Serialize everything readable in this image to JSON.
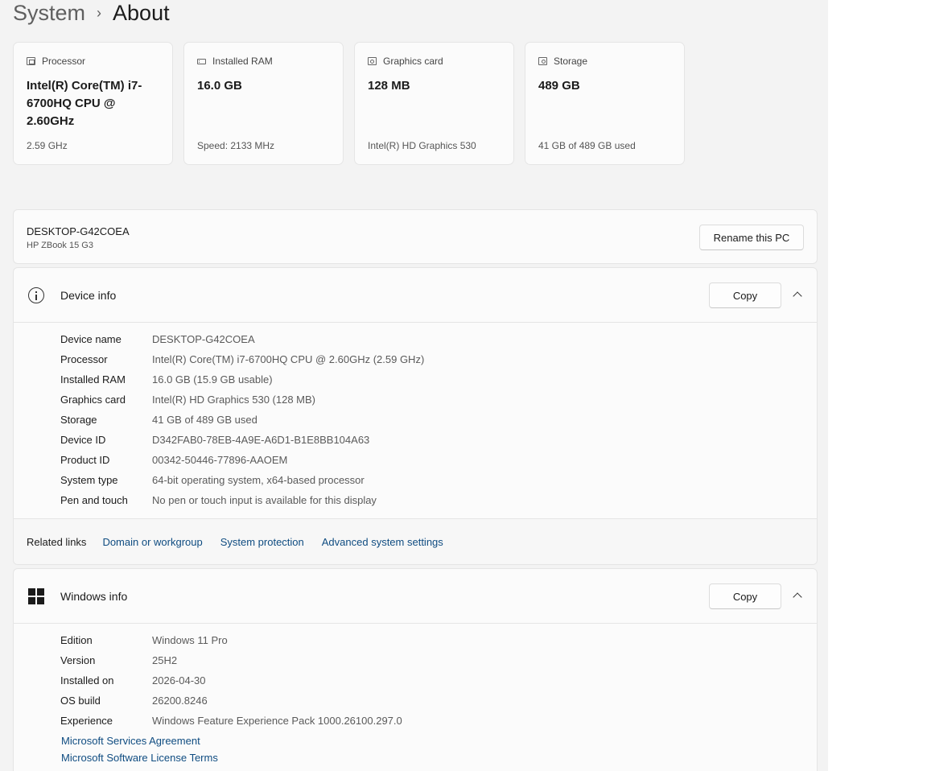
{
  "breadcrumb": {
    "parent": "System",
    "separator": "›",
    "current": "About"
  },
  "spec_cards": [
    {
      "icon": "processor-icon",
      "label": "Processor",
      "value": "Intel(R) Core(TM) i7-6700HQ CPU @ 2.60GHz",
      "sub": "2.59 GHz"
    },
    {
      "icon": "ram-icon",
      "label": "Installed RAM",
      "value": "16.0 GB",
      "sub": "Speed: 2133 MHz"
    },
    {
      "icon": "graphics-card-icon",
      "label": "Graphics card",
      "value": "128 MB",
      "sub": "Intel(R) HD Graphics 530"
    },
    {
      "icon": "storage-icon",
      "label": "Storage",
      "value": "489 GB",
      "sub": "41 GB of 489 GB used"
    }
  ],
  "pc": {
    "name": "DESKTOP-G42COEA",
    "model": "HP ZBook 15 G3",
    "rename_label": "Rename this PC"
  },
  "device_info": {
    "title": "Device info",
    "copy_label": "Copy",
    "rows": [
      {
        "label": "Device name",
        "value": "DESKTOP-G42COEA"
      },
      {
        "label": "Processor",
        "value": "Intel(R) Core(TM) i7-6700HQ CPU @ 2.60GHz (2.59 GHz)"
      },
      {
        "label": "Installed RAM",
        "value": "16.0 GB (15.9 GB usable)"
      },
      {
        "label": "Graphics card",
        "value": "Intel(R) HD Graphics 530 (128 MB)"
      },
      {
        "label": "Storage",
        "value": "41 GB of 489 GB used"
      },
      {
        "label": "Device ID",
        "value": "D342FAB0-78EB-4A9E-A6D1-B1E8BB104A63"
      },
      {
        "label": "Product ID",
        "value": "00342-50446-77896-AAOEM"
      },
      {
        "label": "System type",
        "value": "64-bit operating system, x64-based processor"
      },
      {
        "label": "Pen and touch",
        "value": "No pen or touch input is available for this display"
      }
    ]
  },
  "related_links": {
    "label": "Related links",
    "links": [
      "Domain or workgroup",
      "System protection",
      "Advanced system settings"
    ]
  },
  "windows_info": {
    "title": "Windows info",
    "copy_label": "Copy",
    "rows": [
      {
        "label": "Edition",
        "value": "Windows 11 Pro"
      },
      {
        "label": "Version",
        "value": "25H2"
      },
      {
        "label": "Installed on",
        "value": "2026-04-30"
      },
      {
        "label": "OS build",
        "value": "26200.8246"
      },
      {
        "label": "Experience",
        "value": "Windows Feature Experience Pack 1000.26100.297.0"
      }
    ],
    "links": [
      "Microsoft Services Agreement",
      "Microsoft Software License Terms"
    ]
  }
}
